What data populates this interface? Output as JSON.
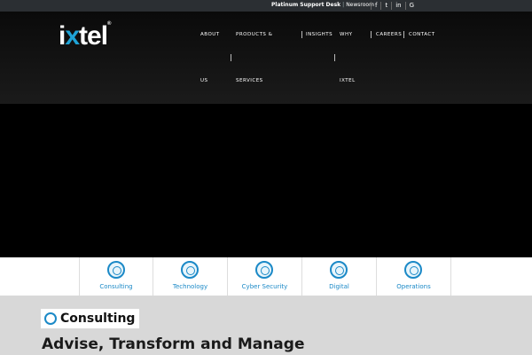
{
  "topbar": {
    "support_label": "Platinum Support Desk",
    "separator": "|",
    "newsroom_label": "Newsroom",
    "social": [
      "f",
      "t",
      "in",
      "G"
    ]
  },
  "logo": {
    "pre": "i",
    "accent": "x",
    "post": "tel",
    "mark": "®"
  },
  "nav": {
    "about_1": "ABOUT",
    "about_2": "US",
    "products_1": "PRODUCTS &",
    "products_2": "SERVICES",
    "insights": "INSIGHTS",
    "why_1": "WHY",
    "why_2": "IXTEL",
    "careers": "CAREERS",
    "contact": "CONTACT"
  },
  "services": [
    {
      "label": "Consulting",
      "icon": "consulting-icon"
    },
    {
      "label": "Technology",
      "icon": "chip-icon"
    },
    {
      "label": "Cyber Security",
      "icon": "shield-network-icon"
    },
    {
      "label": "Digital",
      "icon": "target-icon"
    },
    {
      "label": "Operations",
      "icon": "gears-icon"
    }
  ],
  "section": {
    "badge": "Consulting",
    "heading": "Advise, Transform and Manage"
  },
  "colors": {
    "accent": "#1b89c7",
    "topbar": "#2b2f33"
  }
}
